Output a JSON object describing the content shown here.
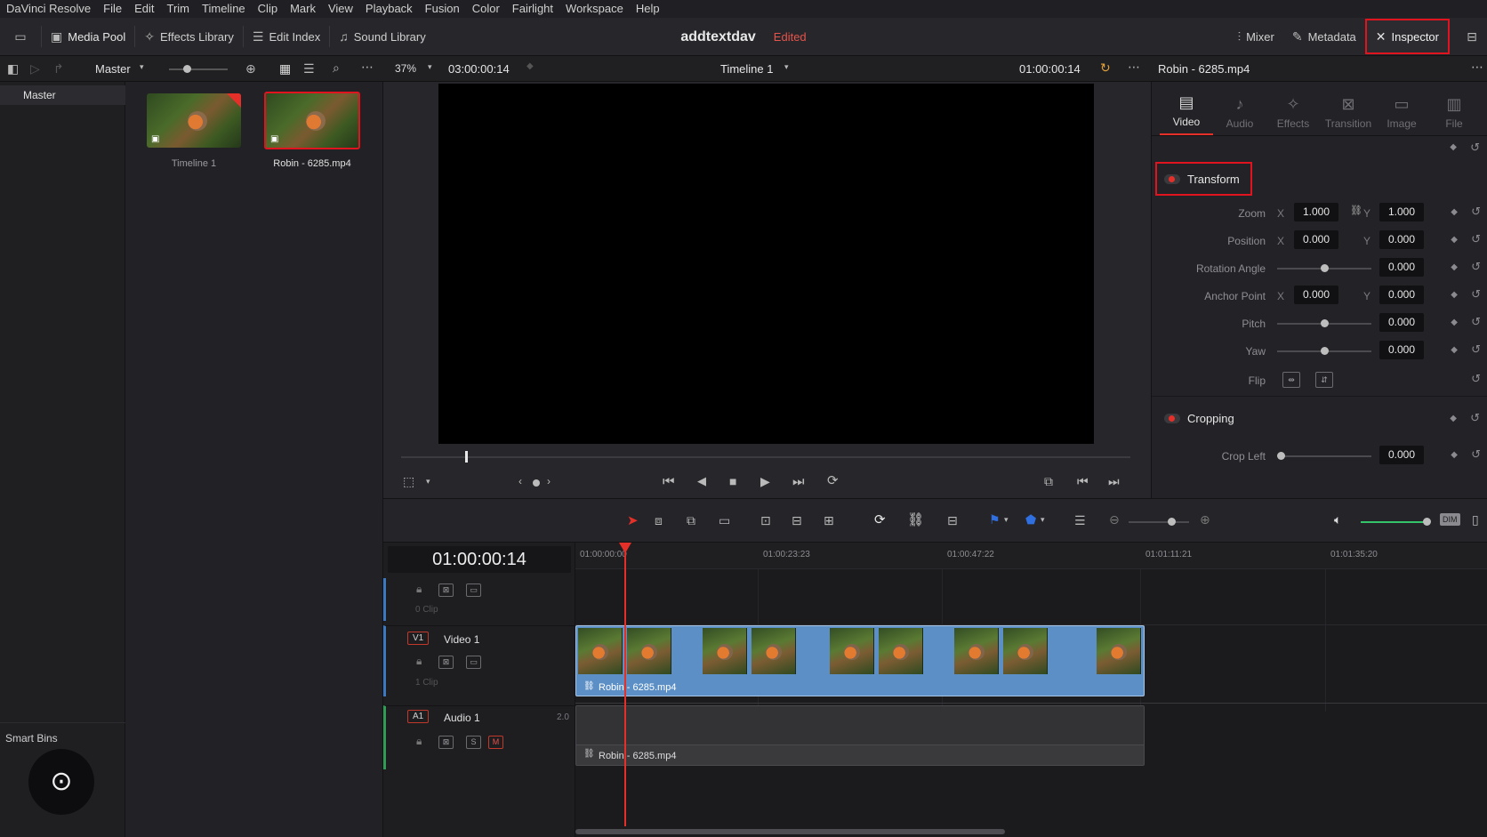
{
  "menu": [
    "DaVinci Resolve",
    "File",
    "Edit",
    "Trim",
    "Timeline",
    "Clip",
    "Mark",
    "View",
    "Playback",
    "Fusion",
    "Color",
    "Fairlight",
    "Workspace",
    "Help"
  ],
  "toolbar": {
    "media_pool": "Media Pool",
    "effects_library": "Effects Library",
    "edit_index": "Edit Index",
    "sound_library": "Sound Library",
    "project_name": "addtextdav",
    "project_status": "Edited",
    "mixer": "Mixer",
    "metadata": "Metadata",
    "inspector": "Inspector"
  },
  "subbar": {
    "bin_name": "Master",
    "zoom": "37%",
    "source_timecode": "03:00:00:14",
    "timeline_name": "Timeline 1",
    "record_timecode": "01:00:00:14",
    "clip_name": "Robin - 6285.mp4"
  },
  "bins": {
    "master": "Master",
    "smart_bins": "Smart Bins"
  },
  "media_pool": {
    "items": [
      {
        "label": "Timeline 1"
      },
      {
        "label": "Robin - 6285.mp4"
      }
    ]
  },
  "inspector": {
    "tabs": [
      "Video",
      "Audio",
      "Effects",
      "Transition",
      "Image",
      "File"
    ],
    "transform_title": "Transform",
    "zoom_label": "Zoom",
    "zoom_x": "1.000",
    "zoom_y": "1.000",
    "position_label": "Position",
    "position_x": "0.000",
    "position_y": "0.000",
    "rotation_label": "Rotation Angle",
    "rotation": "0.000",
    "anchor_label": "Anchor Point",
    "anchor_x": "0.000",
    "anchor_y": "0.000",
    "pitch_label": "Pitch",
    "pitch": "0.000",
    "yaw_label": "Yaw",
    "yaw": "0.000",
    "flip_label": "Flip",
    "cropping_title": "Cropping",
    "crop_left_label": "Crop Left",
    "crop_left": "0.000",
    "axis_x": "X",
    "axis_y": "Y"
  },
  "timeline": {
    "timecode": "01:00:00:14",
    "ruler": [
      "01:00:00:00",
      "01:00:23:23",
      "01:00:47:22",
      "01:01:11:21",
      "01:01:35:20"
    ],
    "v_top_info": "0 Clip",
    "video_track": {
      "tag": "V1",
      "name": "Video 1",
      "info": "1 Clip"
    },
    "audio_track": {
      "tag": "A1",
      "name": "Audio 1",
      "channels": "2.0",
      "solo": "S",
      "mute": "M"
    },
    "video_clip_name": "Robin - 6285.mp4",
    "audio_clip_name": "Robin - 6285.mp4",
    "dim": "DIM"
  },
  "colors": {
    "accent_red": "#e0141e",
    "clip_blue": "#5b8fc6",
    "playhead": "#e5302a",
    "audio_clip": "#3a3a3d"
  }
}
